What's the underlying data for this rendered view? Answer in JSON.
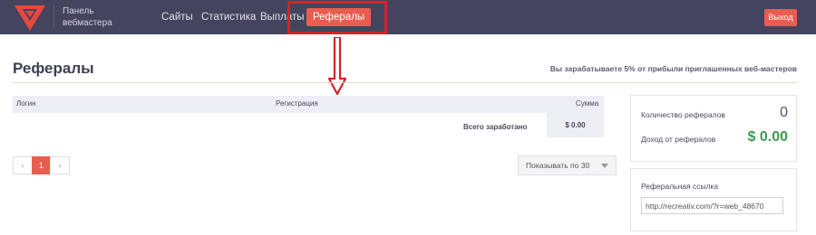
{
  "brand": {
    "line1": "Панель",
    "line2": "вебмастера"
  },
  "nav": {
    "sites": "Сайты",
    "stats": "Статистика",
    "payouts": "Выплаты",
    "referrals": "Рефералы",
    "logout": "Выход"
  },
  "page": {
    "title": "Рефералы",
    "subtitle": "Вы зарабатываете 5% от прибыли приглашенных веб-мастеров"
  },
  "table": {
    "columns": [
      "Логин",
      "Регистрация",
      "Сумма"
    ],
    "total_label": "Всего заработано",
    "total_value": "$ 0.00"
  },
  "pagination": {
    "prev": "‹",
    "current": "1",
    "next": "›"
  },
  "per_page": "Показывать по 30",
  "stats": {
    "count_label": "Количество рефералов",
    "count_value": "0",
    "income_label": "Доход от рефералов",
    "income_value": "$ 0.00"
  },
  "ref_link": {
    "label": "Реферальная ссылка",
    "value": "http://recreativ.com/?r=web_48670"
  },
  "colors": {
    "accent": "#e85d4f",
    "topbar": "#45445f",
    "money": "#3d9a52",
    "annotation": "#d4222a"
  }
}
